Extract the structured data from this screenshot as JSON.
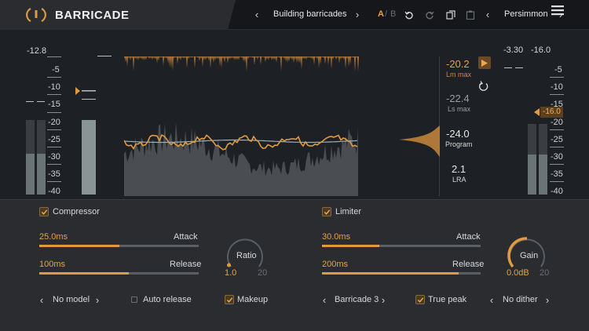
{
  "app": {
    "title": "BARRICADE"
  },
  "preset": {
    "name": "Building barricades"
  },
  "ab": {
    "a": "A",
    "sep": "/",
    "b": "B"
  },
  "theme": {
    "name": "Persimmon"
  },
  "left_meter": {
    "peak": "-12.8",
    "scale": [
      "-5",
      "-10",
      "-15",
      "-20",
      "-25",
      "-30",
      "-35",
      "-40"
    ]
  },
  "right_meter": {
    "peak_left": "-3.30",
    "peak_right": "-16.0",
    "target_badge": "-16.0",
    "scale": [
      "-5",
      "-10",
      "-15",
      "-20",
      "-25",
      "-30",
      "-35",
      "-40"
    ]
  },
  "loudness": {
    "lm_value": "-20.2",
    "lm_label": "Lm max",
    "ls_value": "-22.4",
    "ls_label": "Ls max",
    "program_value": "-24.0",
    "program_label": "Program",
    "lra_value": "2.1",
    "lra_label": "LRA"
  },
  "compressor": {
    "label": "Compressor",
    "enabled": true,
    "attack_value": "25.0ms",
    "attack_label": "Attack",
    "attack_fraction": 0.5,
    "release_value": "100ms",
    "release_label": "Release",
    "release_fraction": 0.56,
    "ratio_label": "Ratio",
    "ratio_value": "1.0",
    "ratio_max": "20",
    "model": "No model",
    "auto_release_label": "Auto release",
    "auto_release": false,
    "makeup_label": "Makeup",
    "makeup": true
  },
  "limiter": {
    "label": "Limiter",
    "enabled": true,
    "attack_value": "30.0ms",
    "attack_label": "Attack",
    "attack_fraction": 0.36,
    "release_value": "200ms",
    "release_label": "Release",
    "release_fraction": 0.86,
    "gain_label": "Gain",
    "gain_value": "0.0dB",
    "gain_max": "20",
    "model": "Barricade 3",
    "true_peak_label": "True peak",
    "true_peak": true,
    "dither": "No dither"
  },
  "colors": {
    "accent": "#e09a40",
    "background": "#1d2024",
    "panel": "#2a2c30"
  }
}
